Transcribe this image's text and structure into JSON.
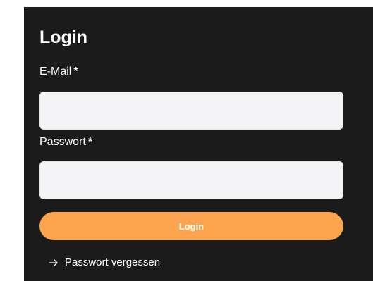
{
  "form": {
    "title": "Login",
    "email": {
      "label": "E-Mail",
      "required_mark": "*",
      "value": "",
      "placeholder": ""
    },
    "password": {
      "label": "Passwort",
      "required_mark": "*",
      "value": "",
      "placeholder": ""
    },
    "submit_label": "Login",
    "forgot_password_label": "Passwort vergessen",
    "forgot_password_icon": "arrow-right-icon"
  },
  "colors": {
    "panel_background": "#1b1b1b",
    "accent": "#fda54e",
    "input_background": "#f3f3f5",
    "text": "#ffffff"
  }
}
